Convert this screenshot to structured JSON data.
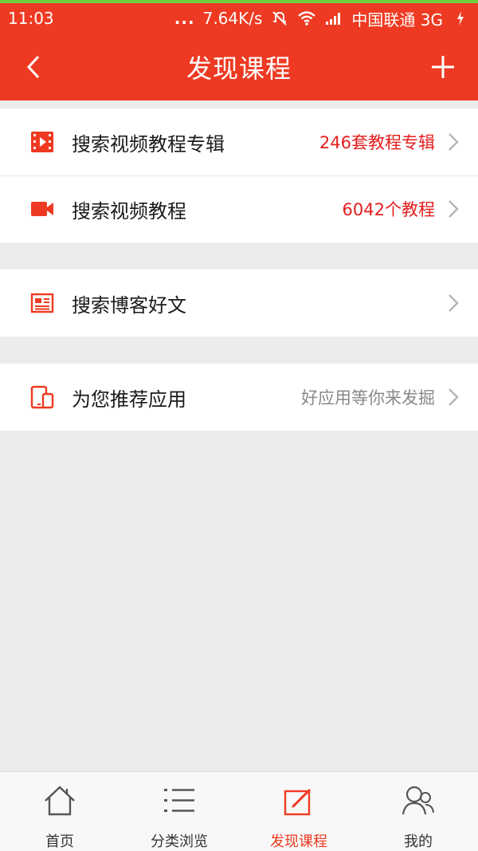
{
  "status_bar": {
    "time": "11:03",
    "dots": "...",
    "speed": "7.64K/s",
    "carrier": "中国联通 3G"
  },
  "app_bar": {
    "title": "发现课程",
    "back_icon": "chevron-left-icon",
    "add_icon": "plus-icon"
  },
  "groups": [
    {
      "rows": [
        {
          "icon": "film-icon",
          "label": "搜索视频教程专辑",
          "value": "246套教程专辑"
        },
        {
          "icon": "video-camera-icon",
          "label": "搜索视频教程",
          "value": "6042个教程"
        }
      ]
    },
    {
      "rows": [
        {
          "icon": "article-icon",
          "label": "搜索博客好文",
          "value": ""
        }
      ]
    },
    {
      "rows": [
        {
          "icon": "devices-icon",
          "label": "为您推荐应用",
          "value": "好应用等你来发掘"
        }
      ]
    }
  ],
  "bottom_nav": [
    {
      "icon": "home-icon",
      "label": "首页",
      "active": false
    },
    {
      "icon": "list-icon",
      "label": "分类浏览",
      "active": false
    },
    {
      "icon": "edit-icon",
      "label": "发现课程",
      "active": true
    },
    {
      "icon": "user-icon",
      "label": "我的",
      "active": false
    }
  ],
  "colors": {
    "accent": "#ee3a22",
    "value_red": "#e41e1e",
    "value_gray": "#888888",
    "status_top_line": "#6fcf3f"
  }
}
